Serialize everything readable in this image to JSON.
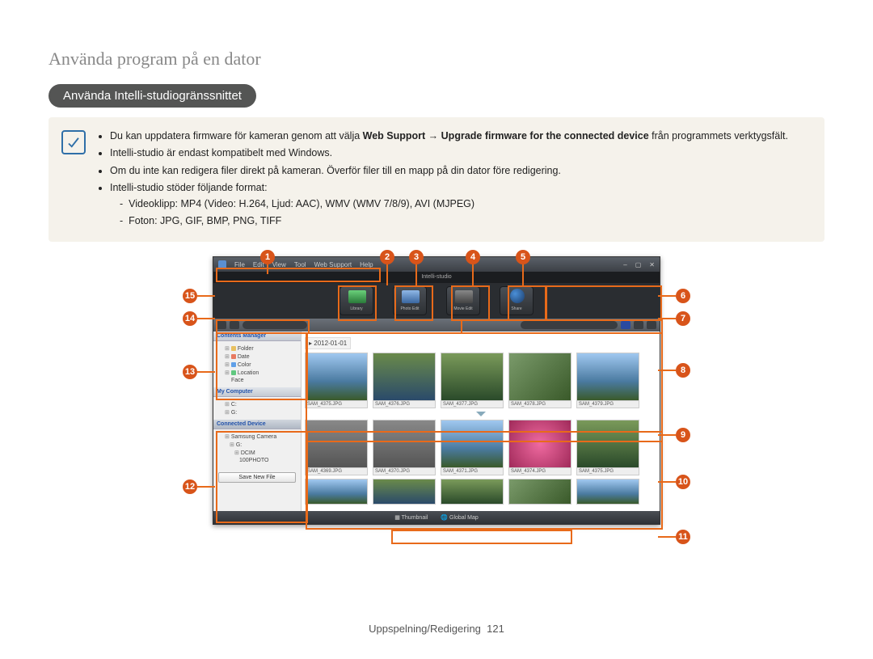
{
  "page_title": "Använda program på en dator",
  "section_heading": "Använda Intelli-studiogränssnittet",
  "info": {
    "line1_pre": "Du kan uppdatera firmware för kameran genom att välja ",
    "line1_b1": "Web Support",
    "line1_arrow": " → ",
    "line1_b2": "Upgrade firmware for the connected device",
    "line1_post": " från programmets verktygsfält.",
    "line2": "Intelli-studio är endast kompatibelt med Windows.",
    "line3": "Om du inte kan redigera filer direkt på kameran. Överför filer till en mapp på din dator före redigering.",
    "line4": "Intelli-studio stöder följande format:",
    "sub1": "Videoklipp: MP4 (Video: H.264, Ljud: AAC), WMV (WMV 7/8/9), AVI (MJPEG)",
    "sub2": "Foton: JPG, GIF, BMP, PNG, TIFF"
  },
  "menubar": [
    "File",
    "Edit",
    "View",
    "Tool",
    "Web Support",
    "Help"
  ],
  "branding": "Intelli-studio",
  "top_buttons": [
    "Library",
    "Photo Edit",
    "Movie Edit",
    "Share"
  ],
  "sidebar": {
    "h1": "Contents Manager",
    "items1": [
      "Folder",
      "Date",
      "Color",
      "Location",
      "Face"
    ],
    "h2": "My Computer",
    "items2": [
      "C:",
      "G:"
    ],
    "h3": "Connected Device",
    "items3": [
      "Samsung Camera",
      "G:",
      "DCIM",
      "100PHOTO"
    ],
    "save": "Save New File"
  },
  "date_header": "2012-01-01",
  "thumbs_row1": [
    "SAM_4375.JPG",
    "SAM_4376.JPG",
    "SAM_4377.JPG",
    "SAM_4378.JPG",
    "SAM_4379.JPG"
  ],
  "thumbs_row2": [
    "SAM_4369.JPG",
    "SAM_4370.JPG",
    "SAM_4371.JPG",
    "SAM_4374.JPG",
    "SAM_4375.JPG"
  ],
  "bottom_tabs": [
    "Thumbnail",
    "Global Map"
  ],
  "footer_label": "Uppspelning/Redigering",
  "footer_page": "121",
  "callouts": [
    "1",
    "2",
    "3",
    "4",
    "5",
    "6",
    "7",
    "8",
    "9",
    "10",
    "11",
    "12",
    "13",
    "14",
    "15"
  ]
}
